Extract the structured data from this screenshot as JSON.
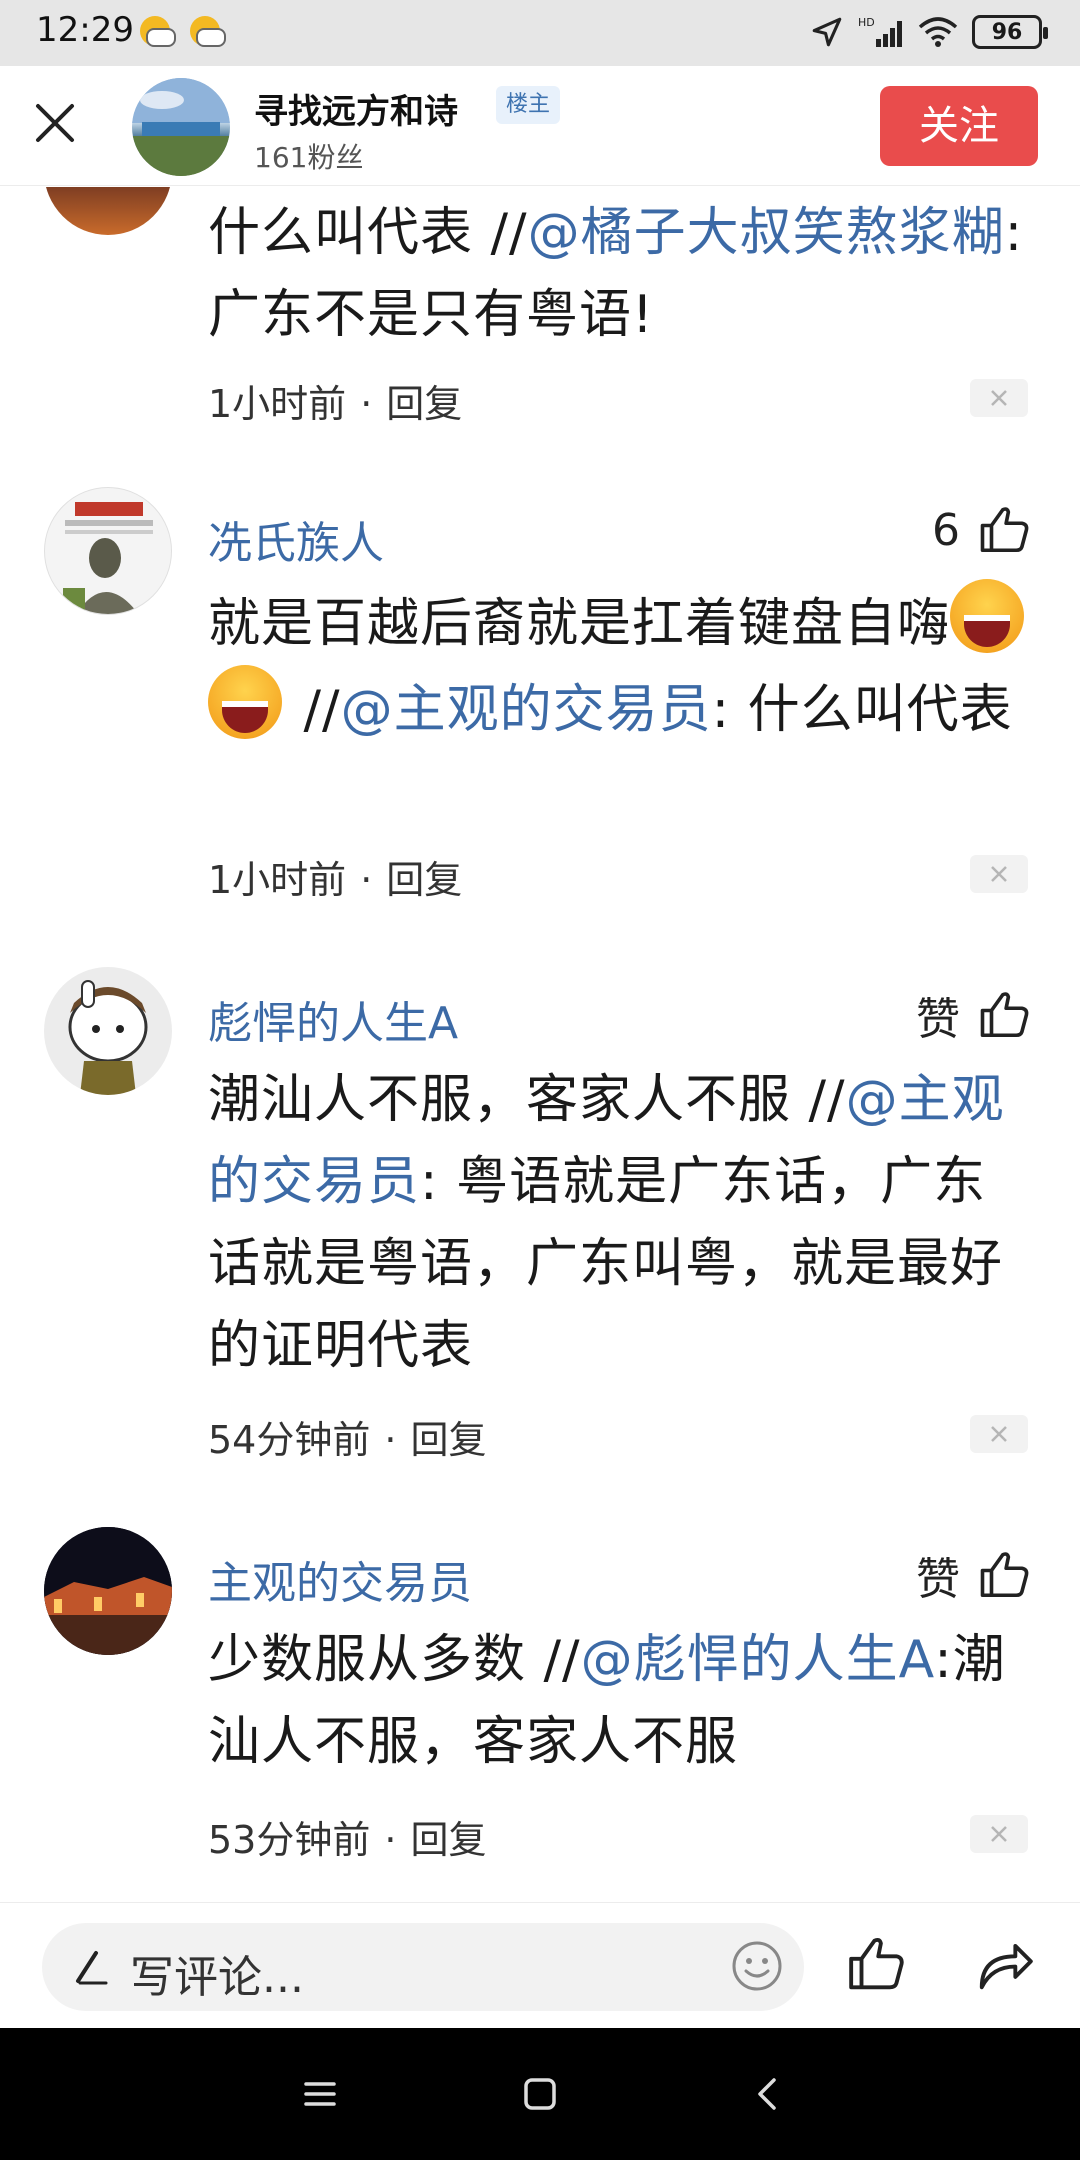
{
  "status_bar": {
    "time": "12:29",
    "battery": "96",
    "network": "HD"
  },
  "header": {
    "user_name": "寻找远方和诗",
    "owner_badge": "楼主",
    "fans": "161粉丝",
    "follow_label": "关注"
  },
  "comments": [
    {
      "name": "",
      "likes": "",
      "text_plain_1": "什么叫代表 //",
      "mention": "@橘子大叔笑熬浆糊",
      "text_plain_2": ": 广东不是只有粤语!",
      "time": "1小时前",
      "reply": "回复"
    },
    {
      "name": "冼氏族人",
      "likes": "6",
      "text_plain_1": "就是百越后裔就是扛着键盘自嗨",
      "text_plain_2": " //",
      "mention": "@主观的交易员",
      "text_plain_3": ": 什么叫代表",
      "time": "1小时前",
      "reply": "回复"
    },
    {
      "name": "彪悍的人生A",
      "likes": "赞",
      "text_plain_1": "潮汕人不服，客家人不服 //",
      "mention": "@主观的交易员",
      "text_plain_2": ": 粤语就是广东话，广东话就是粤语，广东叫粤，就是最好的证明代表",
      "time": "54分钟前",
      "reply": "回复"
    },
    {
      "name": "主观的交易员",
      "likes": "赞",
      "text_plain_1": "少数服从多数 //",
      "mention": "@彪悍的人生A",
      "text_plain_2": ":潮汕人不服，客家人不服",
      "time": "53分钟前",
      "reply": "回复"
    }
  ],
  "input_bar": {
    "placeholder": "写评论..."
  },
  "colors": {
    "accent": "#3c6aa6",
    "follow": "#e94c4c",
    "badge_bg": "#e8f1fb"
  },
  "icons": [
    "close-icon",
    "thumbs-up-icon",
    "dismiss-icon",
    "pen-icon",
    "smile-icon",
    "share-icon",
    "menu-icon",
    "home-icon",
    "back-icon"
  ]
}
